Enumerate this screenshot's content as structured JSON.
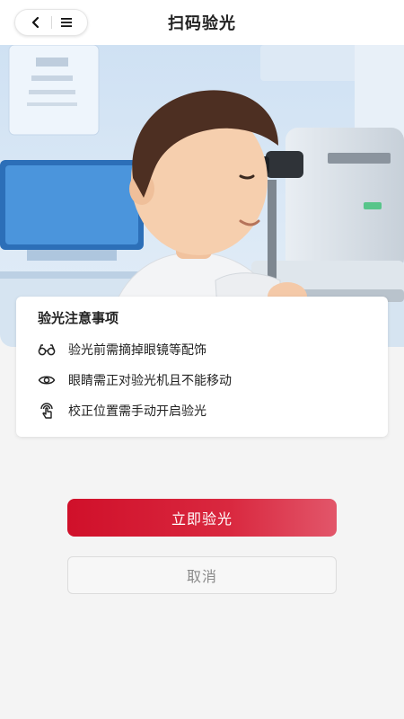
{
  "header": {
    "title": "扫码验光",
    "back_icon": "chevron-left-icon",
    "menu_icon": "hamburger-menu-icon"
  },
  "hero": {
    "image": "doctor-using-eye-examination-machine-illustration"
  },
  "notice": {
    "title": "验光注意事项",
    "items": [
      {
        "icon": "glasses-icon",
        "text": "验光前需摘掉眼镜等配饰"
      },
      {
        "icon": "eye-icon",
        "text": "眼睛需正对验光机且不能移动"
      },
      {
        "icon": "hand-tap-icon",
        "text": "校正位置需手动开启验光"
      }
    ]
  },
  "actions": {
    "primary_label": "立即验光",
    "secondary_label": "取消"
  },
  "colors": {
    "accent": "#d0102a",
    "background": "#f4f4f4"
  }
}
